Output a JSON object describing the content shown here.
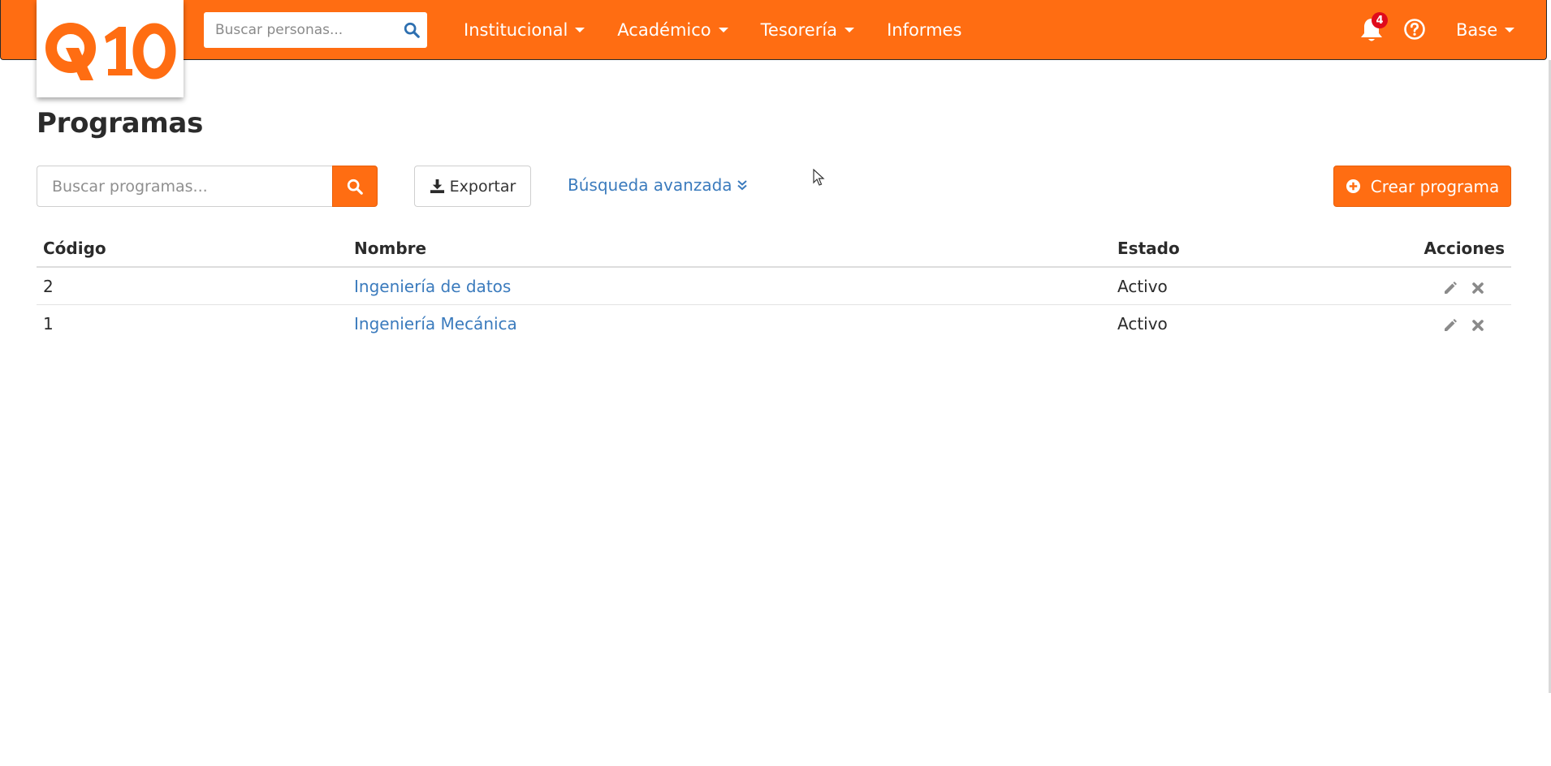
{
  "app": {
    "logo_text": "Q10"
  },
  "navbar": {
    "people_search_placeholder": "Buscar personas...",
    "menu": [
      {
        "label": "Institucional",
        "dropdown": true
      },
      {
        "label": "Académico",
        "dropdown": true
      },
      {
        "label": "Tesorería",
        "dropdown": true
      },
      {
        "label": "Informes",
        "dropdown": false
      }
    ],
    "notifications_count": "4",
    "user_label": "Base"
  },
  "page": {
    "title": "Programas",
    "search_placeholder": "Buscar programas...",
    "export_label": "Exportar",
    "advanced_search_label": "Búsqueda avanzada",
    "create_label": "Crear programa"
  },
  "table": {
    "headers": {
      "code": "Código",
      "name": "Nombre",
      "state": "Estado",
      "actions": "Acciones"
    },
    "rows": [
      {
        "code": "2",
        "name": "Ingeniería de datos",
        "state": "Activo"
      },
      {
        "code": "1",
        "name": "Ingeniería Mecánica",
        "state": "Activo"
      }
    ]
  },
  "colors": {
    "brand_orange": "#ff6d12",
    "link_blue": "#3b7bbd",
    "badge_red": "#e00b1c"
  },
  "icons": {
    "search": "search-icon",
    "bell": "bell-icon",
    "help": "help-circle-icon",
    "download": "download-icon",
    "double_chevron": "double-chevron-down-icon",
    "plus_circle": "plus-circle-icon",
    "edit": "pencil-icon",
    "delete": "close-icon"
  }
}
